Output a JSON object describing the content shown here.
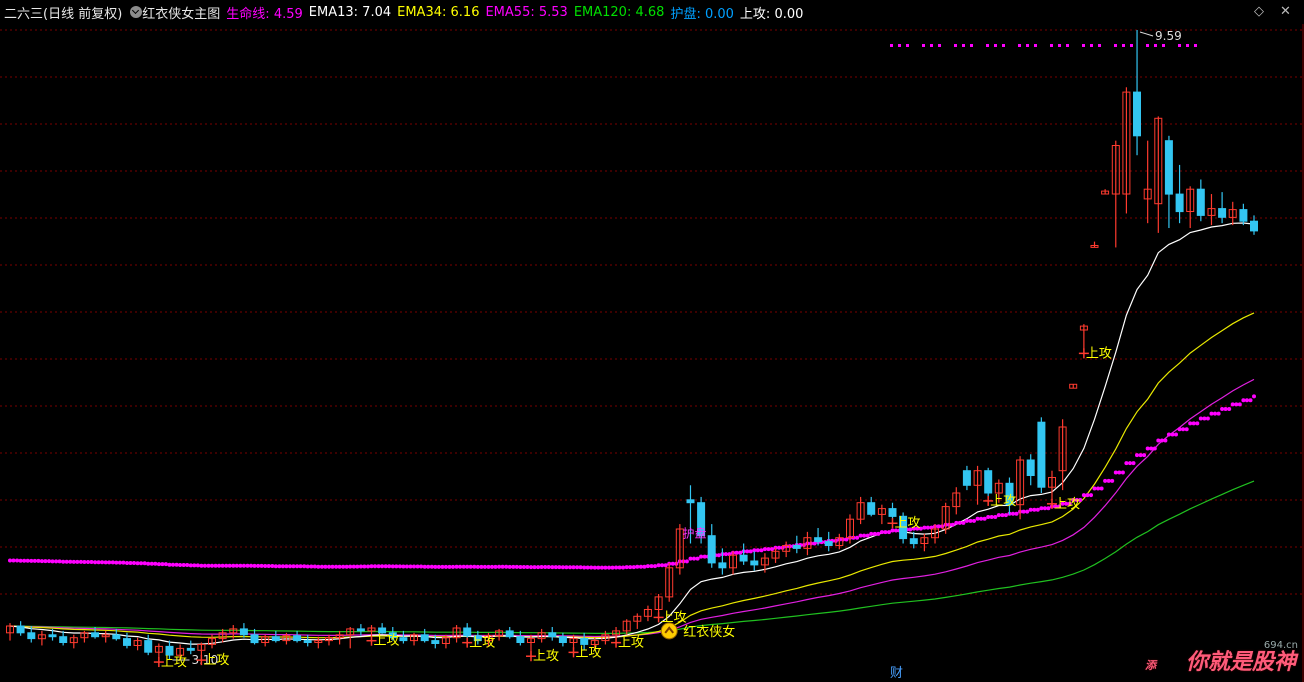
{
  "header": {
    "title": "二六三(日线 前复权)",
    "formula": "红衣侠女主图",
    "items": [
      {
        "label": "生命线:",
        "value": "4.59",
        "color": "#ff00ff"
      },
      {
        "label": "EMA13:",
        "value": "7.04",
        "color": "#ffffff"
      },
      {
        "label": "EMA34:",
        "value": "6.16",
        "color": "#ffff00"
      },
      {
        "label": "EMA55:",
        "value": "5.53",
        "color": "#ff00ff"
      },
      {
        "label": "EMA120:",
        "value": "4.68",
        "color": "#00ff00"
      },
      {
        "label": "护盘:",
        "value": "0.00",
        "color": "#00a0ff"
      },
      {
        "label": "上攻:",
        "value": "0.00",
        "color": "#ffffff"
      }
    ]
  },
  "icons": {
    "diamond": "diamond-icon",
    "close": "close-icon",
    "dropdown": "chevron-down-icon"
  },
  "annotations": {
    "high_label": "9.59",
    "low_label": "3.10",
    "signal_attack": "上攻",
    "signal_protect": "护盘",
    "signal_hero": "红衣侠女",
    "finance_marker": "财"
  },
  "watermark": {
    "text": "你就是股神",
    "site": "694.cn",
    "corner_text": "添"
  },
  "colors": {
    "up": "#ff3b2f",
    "down": "#33c6f2",
    "grid": "#7a0000",
    "ema13": "#ffffff",
    "ema34": "#e8e800",
    "ema55": "#e020e0",
    "ema120": "#20c020",
    "lifeline_dots": "#ff00ff",
    "signal_text": "#ffff00"
  },
  "chart_data": {
    "type": "candlestick",
    "price_high": 9.59,
    "price_low": 3.1,
    "candles": [
      {
        "o": 3.38,
        "h": 3.48,
        "l": 3.3,
        "c": 3.45
      },
      {
        "o": 3.45,
        "h": 3.5,
        "l": 3.35,
        "c": 3.38
      },
      {
        "o": 3.38,
        "h": 3.45,
        "l": 3.28,
        "c": 3.32
      },
      {
        "o": 3.32,
        "h": 3.4,
        "l": 3.25,
        "c": 3.36
      },
      {
        "o": 3.36,
        "h": 3.42,
        "l": 3.3,
        "c": 3.34
      },
      {
        "o": 3.34,
        "h": 3.4,
        "l": 3.25,
        "c": 3.28
      },
      {
        "o": 3.28,
        "h": 3.36,
        "l": 3.22,
        "c": 3.33
      },
      {
        "o": 3.33,
        "h": 3.4,
        "l": 3.28,
        "c": 3.38
      },
      {
        "o": 3.38,
        "h": 3.44,
        "l": 3.32,
        "c": 3.34
      },
      {
        "o": 3.34,
        "h": 3.4,
        "l": 3.28,
        "c": 3.36
      },
      {
        "o": 3.36,
        "h": 3.42,
        "l": 3.3,
        "c": 3.32
      },
      {
        "o": 3.32,
        "h": 3.38,
        "l": 3.22,
        "c": 3.25
      },
      {
        "o": 3.25,
        "h": 3.33,
        "l": 3.2,
        "c": 3.3
      },
      {
        "o": 3.3,
        "h": 3.36,
        "l": 3.15,
        "c": 3.18
      },
      {
        "o": 3.18,
        "h": 3.27,
        "l": 3.12,
        "c": 3.24
      },
      {
        "o": 3.24,
        "h": 3.3,
        "l": 3.1,
        "c": 3.15
      },
      {
        "o": 3.15,
        "h": 3.26,
        "l": 3.12,
        "c": 3.22
      },
      {
        "o": 3.22,
        "h": 3.3,
        "l": 3.16,
        "c": 3.2
      },
      {
        "o": 3.2,
        "h": 3.28,
        "l": 3.14,
        "c": 3.26
      },
      {
        "o": 3.26,
        "h": 3.36,
        "l": 3.22,
        "c": 3.32
      },
      {
        "o": 3.32,
        "h": 3.42,
        "l": 3.28,
        "c": 3.38
      },
      {
        "o": 3.38,
        "h": 3.46,
        "l": 3.32,
        "c": 3.42
      },
      {
        "o": 3.42,
        "h": 3.48,
        "l": 3.33,
        "c": 3.36
      },
      {
        "o": 3.36,
        "h": 3.42,
        "l": 3.26,
        "c": 3.28
      },
      {
        "o": 3.28,
        "h": 3.36,
        "l": 3.24,
        "c": 3.34
      },
      {
        "o": 3.34,
        "h": 3.4,
        "l": 3.28,
        "c": 3.3
      },
      {
        "o": 3.3,
        "h": 3.38,
        "l": 3.26,
        "c": 3.35
      },
      {
        "o": 3.35,
        "h": 3.4,
        "l": 3.28,
        "c": 3.3
      },
      {
        "o": 3.3,
        "h": 3.36,
        "l": 3.24,
        "c": 3.28
      },
      {
        "o": 3.28,
        "h": 3.34,
        "l": 3.22,
        "c": 3.3
      },
      {
        "o": 3.3,
        "h": 3.36,
        "l": 3.25,
        "c": 3.33
      },
      {
        "o": 3.33,
        "h": 3.4,
        "l": 3.26,
        "c": 3.36
      },
      {
        "o": 3.36,
        "h": 3.44,
        "l": 3.22,
        "c": 3.42
      },
      {
        "o": 3.42,
        "h": 3.47,
        "l": 3.35,
        "c": 3.4
      },
      {
        "o": 3.4,
        "h": 3.46,
        "l": 3.34,
        "c": 3.43
      },
      {
        "o": 3.43,
        "h": 3.48,
        "l": 3.37,
        "c": 3.38
      },
      {
        "o": 3.38,
        "h": 3.44,
        "l": 3.3,
        "c": 3.33
      },
      {
        "o": 3.33,
        "h": 3.4,
        "l": 3.27,
        "c": 3.3
      },
      {
        "o": 3.3,
        "h": 3.38,
        "l": 3.25,
        "c": 3.36
      },
      {
        "o": 3.36,
        "h": 3.42,
        "l": 3.28,
        "c": 3.3
      },
      {
        "o": 3.3,
        "h": 3.36,
        "l": 3.22,
        "c": 3.27
      },
      {
        "o": 3.27,
        "h": 3.36,
        "l": 3.22,
        "c": 3.33
      },
      {
        "o": 3.33,
        "h": 3.46,
        "l": 3.28,
        "c": 3.43
      },
      {
        "o": 3.43,
        "h": 3.48,
        "l": 3.32,
        "c": 3.35
      },
      {
        "o": 3.35,
        "h": 3.4,
        "l": 3.26,
        "c": 3.3
      },
      {
        "o": 3.3,
        "h": 3.38,
        "l": 3.24,
        "c": 3.35
      },
      {
        "o": 3.35,
        "h": 3.42,
        "l": 3.3,
        "c": 3.4
      },
      {
        "o": 3.4,
        "h": 3.44,
        "l": 3.32,
        "c": 3.34
      },
      {
        "o": 3.34,
        "h": 3.4,
        "l": 3.25,
        "c": 3.28
      },
      {
        "o": 3.28,
        "h": 3.36,
        "l": 3.18,
        "c": 3.32
      },
      {
        "o": 3.32,
        "h": 3.42,
        "l": 3.28,
        "c": 3.38
      },
      {
        "o": 3.38,
        "h": 3.44,
        "l": 3.3,
        "c": 3.34
      },
      {
        "o": 3.34,
        "h": 3.38,
        "l": 3.24,
        "c": 3.28
      },
      {
        "o": 3.28,
        "h": 3.36,
        "l": 3.22,
        "c": 3.32
      },
      {
        "o": 3.32,
        "h": 3.38,
        "l": 3.2,
        "c": 3.26
      },
      {
        "o": 3.26,
        "h": 3.33,
        "l": 3.2,
        "c": 3.3
      },
      {
        "o": 3.3,
        "h": 3.4,
        "l": 3.26,
        "c": 3.36
      },
      {
        "o": 3.36,
        "h": 3.44,
        "l": 3.32,
        "c": 3.4
      },
      {
        "o": 3.4,
        "h": 3.52,
        "l": 3.36,
        "c": 3.5
      },
      {
        "o": 3.5,
        "h": 3.58,
        "l": 3.42,
        "c": 3.55
      },
      {
        "o": 3.55,
        "h": 3.66,
        "l": 3.5,
        "c": 3.62
      },
      {
        "o": 3.62,
        "h": 3.78,
        "l": 3.58,
        "c": 3.75
      },
      {
        "o": 3.75,
        "h": 4.1,
        "l": 3.7,
        "c": 4.05
      },
      {
        "o": 4.05,
        "h": 4.5,
        "l": 3.98,
        "c": 4.45
      },
      {
        "o": 4.75,
        "h": 4.9,
        "l": 4.3,
        "c": 4.72
      },
      {
        "o": 4.72,
        "h": 4.78,
        "l": 4.3,
        "c": 4.38
      },
      {
        "o": 4.38,
        "h": 4.5,
        "l": 4.05,
        "c": 4.1
      },
      {
        "o": 4.1,
        "h": 4.25,
        "l": 3.98,
        "c": 4.05
      },
      {
        "o": 4.05,
        "h": 4.22,
        "l": 3.98,
        "c": 4.18
      },
      {
        "o": 4.18,
        "h": 4.3,
        "l": 4.08,
        "c": 4.12
      },
      {
        "o": 4.12,
        "h": 4.22,
        "l": 4.02,
        "c": 4.08
      },
      {
        "o": 4.08,
        "h": 4.2,
        "l": 4.0,
        "c": 4.15
      },
      {
        "o": 4.15,
        "h": 4.26,
        "l": 4.1,
        "c": 4.22
      },
      {
        "o": 4.22,
        "h": 4.32,
        "l": 4.16,
        "c": 4.28
      },
      {
        "o": 4.28,
        "h": 4.38,
        "l": 4.2,
        "c": 4.25
      },
      {
        "o": 4.25,
        "h": 4.42,
        "l": 4.18,
        "c": 4.36
      },
      {
        "o": 4.36,
        "h": 4.46,
        "l": 4.28,
        "c": 4.32
      },
      {
        "o": 4.32,
        "h": 4.42,
        "l": 4.22,
        "c": 4.28
      },
      {
        "o": 4.28,
        "h": 4.4,
        "l": 4.24,
        "c": 4.36
      },
      {
        "o": 4.36,
        "h": 4.6,
        "l": 4.3,
        "c": 4.55
      },
      {
        "o": 4.55,
        "h": 4.78,
        "l": 4.5,
        "c": 4.72
      },
      {
        "o": 4.72,
        "h": 4.78,
        "l": 4.58,
        "c": 4.6
      },
      {
        "o": 4.6,
        "h": 4.7,
        "l": 4.5,
        "c": 4.66
      },
      {
        "o": 4.66,
        "h": 4.72,
        "l": 4.55,
        "c": 4.58
      },
      {
        "o": 4.58,
        "h": 4.62,
        "l": 4.3,
        "c": 4.35
      },
      {
        "o": 4.35,
        "h": 4.42,
        "l": 4.25,
        "c": 4.3
      },
      {
        "o": 4.3,
        "h": 4.4,
        "l": 4.22,
        "c": 4.36
      },
      {
        "o": 4.36,
        "h": 4.5,
        "l": 4.3,
        "c": 4.45
      },
      {
        "o": 4.45,
        "h": 4.72,
        "l": 4.4,
        "c": 4.68
      },
      {
        "o": 4.68,
        "h": 4.88,
        "l": 4.6,
        "c": 4.82
      },
      {
        "o": 5.05,
        "h": 5.1,
        "l": 4.85,
        "c": 4.9
      },
      {
        "o": 4.9,
        "h": 5.1,
        "l": 4.7,
        "c": 5.05
      },
      {
        "o": 5.05,
        "h": 5.08,
        "l": 4.78,
        "c": 4.82
      },
      {
        "o": 4.82,
        "h": 4.96,
        "l": 4.72,
        "c": 4.92
      },
      {
        "o": 4.92,
        "h": 4.98,
        "l": 4.6,
        "c": 4.7
      },
      {
        "o": 4.7,
        "h": 5.2,
        "l": 4.55,
        "c": 5.16
      },
      {
        "o": 5.16,
        "h": 5.22,
        "l": 4.9,
        "c": 5.0
      },
      {
        "o": 5.55,
        "h": 5.6,
        "l": 4.82,
        "c": 4.88
      },
      {
        "o": 4.88,
        "h": 5.05,
        "l": 4.75,
        "c": 4.98
      },
      {
        "o": 5.05,
        "h": 5.58,
        "l": 4.85,
        "c": 5.5
      },
      {
        "o": 5.9,
        "h": 5.94,
        "l": 5.9,
        "c": 5.94
      },
      {
        "o": 6.5,
        "h": 6.56,
        "l": 6.3,
        "c": 6.54
      },
      {
        "o": 7.35,
        "h": 7.41,
        "l": 7.35,
        "c": 7.37
      },
      {
        "o": 7.9,
        "h": 7.95,
        "l": 7.9,
        "c": 7.93
      },
      {
        "o": 7.9,
        "h": 8.45,
        "l": 7.35,
        "c": 8.4
      },
      {
        "o": 7.9,
        "h": 9.0,
        "l": 7.7,
        "c": 8.95
      },
      {
        "o": 8.95,
        "h": 9.59,
        "l": 8.3,
        "c": 8.5
      },
      {
        "o": 7.85,
        "h": 8.45,
        "l": 7.6,
        "c": 7.95
      },
      {
        "o": 7.8,
        "h": 8.7,
        "l": 7.5,
        "c": 8.68
      },
      {
        "o": 8.45,
        "h": 8.5,
        "l": 7.55,
        "c": 7.9
      },
      {
        "o": 7.9,
        "h": 8.2,
        "l": 7.6,
        "c": 7.72
      },
      {
        "o": 7.72,
        "h": 7.98,
        "l": 7.55,
        "c": 7.95
      },
      {
        "o": 7.95,
        "h": 8.05,
        "l": 7.62,
        "c": 7.68
      },
      {
        "o": 7.68,
        "h": 7.9,
        "l": 7.58,
        "c": 7.75
      },
      {
        "o": 7.75,
        "h": 7.92,
        "l": 7.6,
        "c": 7.66
      },
      {
        "o": 7.66,
        "h": 7.82,
        "l": 7.58,
        "c": 7.74
      },
      {
        "o": 7.74,
        "h": 7.8,
        "l": 7.58,
        "c": 7.62
      },
      {
        "o": 7.62,
        "h": 7.68,
        "l": 7.48,
        "c": 7.52
      }
    ]
  }
}
